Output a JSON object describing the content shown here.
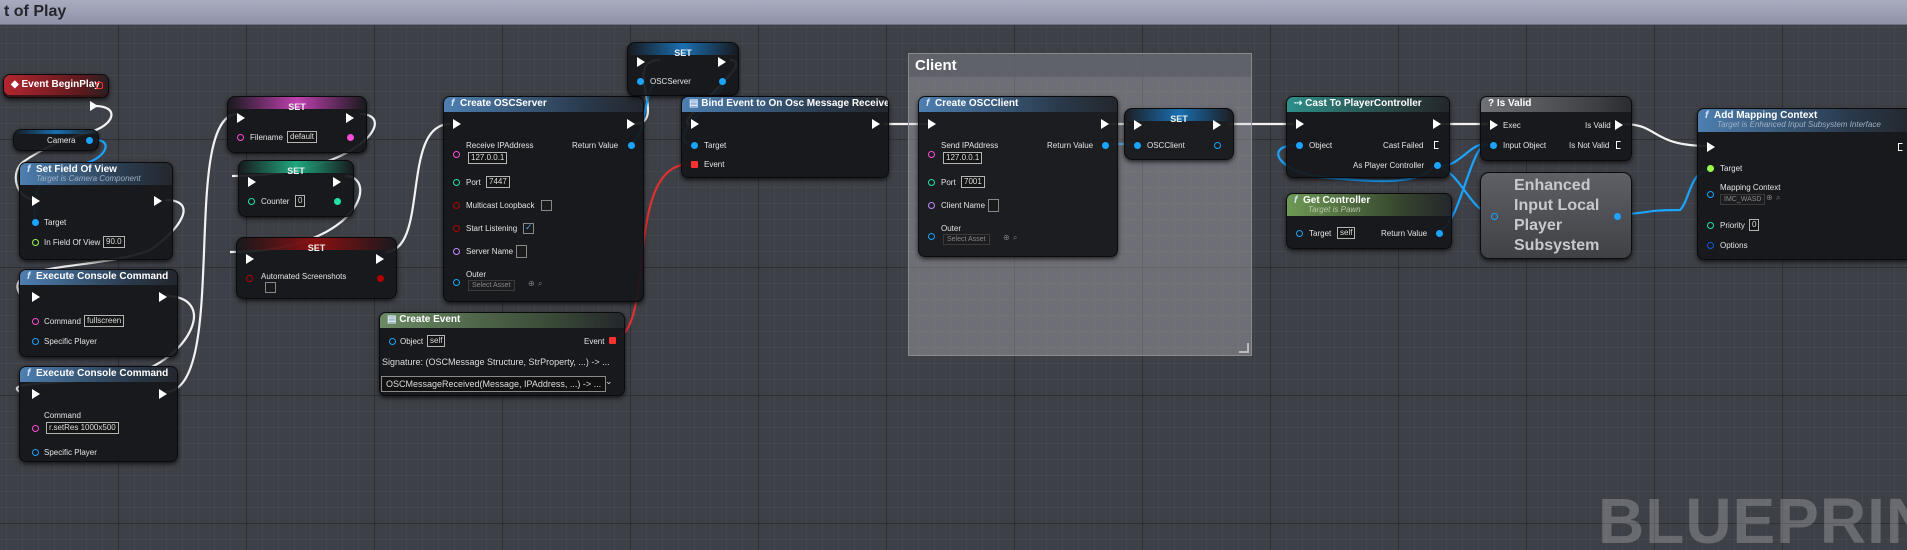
{
  "window": {
    "title": "t of Play",
    "watermark": "BLUEPRINT"
  },
  "colors": {
    "exec": "#ffffff",
    "object": "#1aa4ff",
    "string": "#ff4bd6",
    "name": "#c08aff",
    "int": "#20e3a8",
    "float": "#9afc4a",
    "bool": "#b00000",
    "delegate": "#ff3030",
    "struct": "#0e59d6"
  },
  "comment": {
    "title": "Client"
  },
  "nodes": {
    "event_begin_play": {
      "title": "Event BeginPlay"
    },
    "camera_var": {
      "label": "Camera"
    },
    "set_fov": {
      "title": "Set Field Of View",
      "subtitle": "Target is Camera Component",
      "target": "Target",
      "fov_label": "In Field Of View",
      "fov_value": "90.0"
    },
    "exec_cmd1": {
      "title": "Execute Console Command",
      "command_label": "Command",
      "command_value": "fullscreen",
      "player_label": "Specific Player"
    },
    "exec_cmd2": {
      "title": "Execute Console Command",
      "command_label": "Command",
      "command_value": "r.setRes 1000x500",
      "player_label": "Specific Player"
    },
    "set_filename": {
      "title": "SET",
      "label": "Filename",
      "value": "default"
    },
    "set_counter": {
      "title": "SET",
      "label": "Counter",
      "value": "0"
    },
    "set_screenshots": {
      "title": "SET",
      "label": "Automated Screenshots"
    },
    "create_osc_server": {
      "title": "Create OSCServer",
      "ip_label": "Receive IPAddress",
      "ip_value": "127.0.0.1",
      "return_label": "Return Value",
      "port_label": "Port",
      "port_value": "7447",
      "multicast_label": "Multicast Loopback",
      "listen_label": "Start Listening",
      "server_name_label": "Server Name",
      "outer_label": "Outer",
      "outer_value": "Select Asset"
    },
    "set_osc_server": {
      "title": "SET",
      "label": "OSCServer"
    },
    "bind_event": {
      "title": "Bind Event to On Osc Message Received",
      "target": "Target",
      "event": "Event"
    },
    "create_event": {
      "title": "Create Event",
      "object_label": "Object",
      "object_value": "self",
      "event_label": "Event",
      "signature": "Signature: (OSCMessage Structure, StrProperty, ...) -> ...",
      "selected": "OSCMessageReceived(Message, IPAddress, ...) -> ..."
    },
    "create_osc_client": {
      "title": "Create OSCClient",
      "ip_label": "Send IPAddress",
      "ip_value": "127.0.0.1",
      "return_label": "Return Value",
      "port_label": "Port",
      "port_value": "7001",
      "client_name_label": "Client Name",
      "outer_label": "Outer",
      "outer_value": "Select Asset"
    },
    "set_osc_client": {
      "title": "SET",
      "label": "OSCClient"
    },
    "cast": {
      "title": "Cast To PlayerController",
      "object_label": "Object",
      "failed_label": "Cast Failed",
      "as_label": "As Player Controller"
    },
    "get_controller": {
      "title": "Get Controller",
      "subtitle": "Target is Pawn",
      "target_label": "Target",
      "target_value": "self",
      "return_label": "Return Value"
    },
    "is_valid": {
      "title": "Is Valid",
      "exec_label": "Exec",
      "input_label": "Input Object",
      "valid_label": "Is Valid",
      "not_valid_label": "Is Not Valid"
    },
    "subsystem": {
      "title": "Enhanced Input Local Player Subsystem"
    },
    "add_mapping": {
      "title": "Add Mapping Context",
      "subtitle": "Target is Enhanced Input Subsystem Interface",
      "target_label": "Target",
      "mapping_label": "Mapping Context",
      "mapping_value": "IMC_WASD",
      "priority_label": "Priority",
      "priority_value": "0",
      "options_label": "Options"
    }
  }
}
